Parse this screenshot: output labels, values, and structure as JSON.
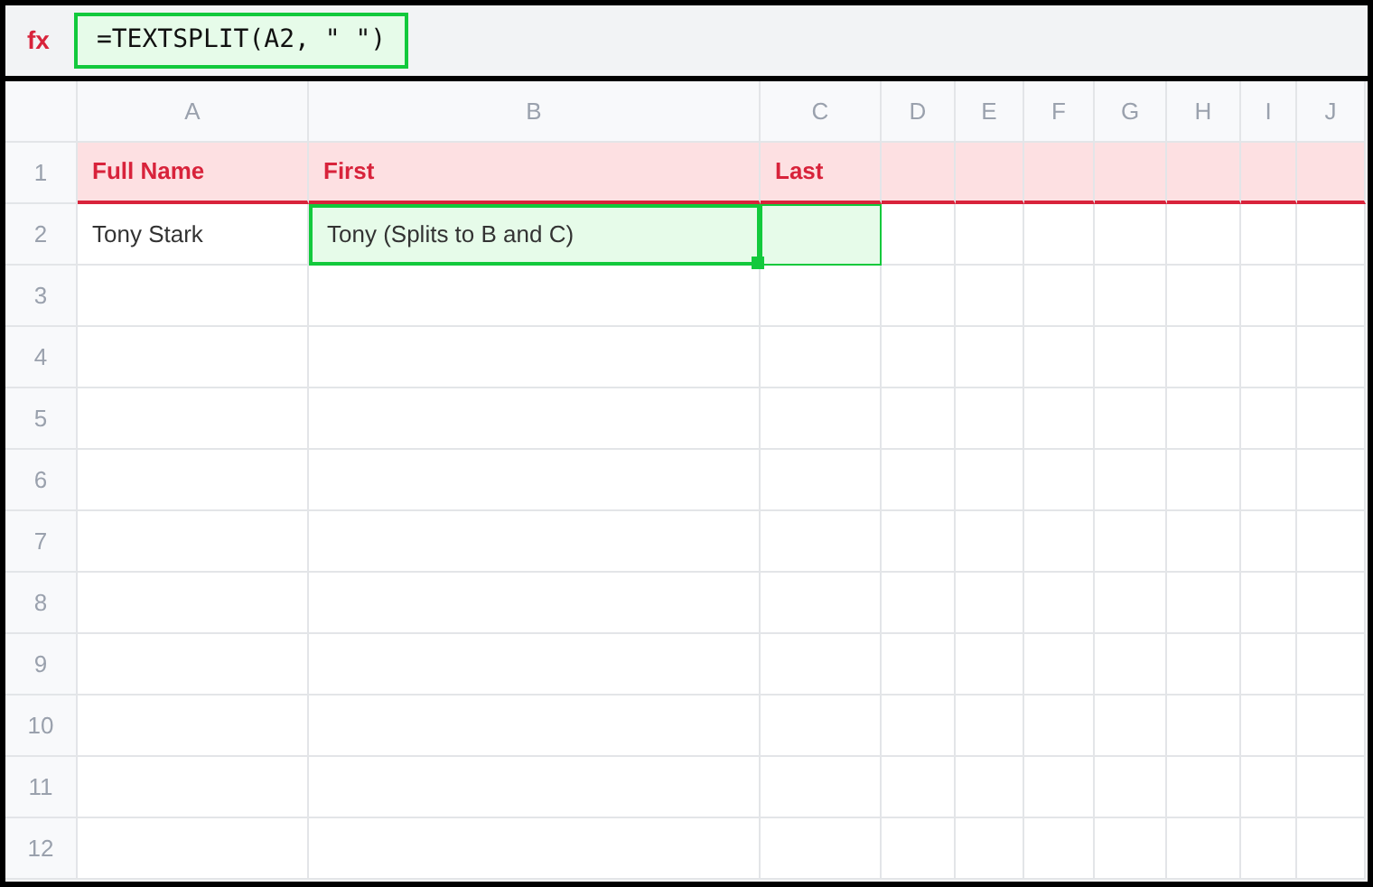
{
  "formula_bar": {
    "label": "fx",
    "formula": "=TEXTSPLIT(A2, \" \")"
  },
  "columns": [
    "A",
    "B",
    "C",
    "D",
    "E",
    "F",
    "G",
    "H",
    "I",
    "J"
  ],
  "rows": [
    {
      "number": "1",
      "kind": "header",
      "cells": [
        {
          "text": "Full Name",
          "selected": false
        },
        {
          "text": "First",
          "selected": false
        },
        {
          "text": "Last",
          "selected": false
        }
      ]
    },
    {
      "number": "2",
      "kind": "data",
      "cells": [
        {
          "text": "Tony Stark",
          "selected": false
        },
        {
          "text": "Tony (Splits to B and C)",
          "selected": true,
          "active": true
        },
        {
          "selected": true,
          "active": false
        }
      ]
    },
    {
      "number": "3"
    },
    {
      "number": "4"
    },
    {
      "number": "5"
    },
    {
      "number": "6"
    },
    {
      "number": "7"
    },
    {
      "number": "8"
    },
    {
      "number": "9"
    },
    {
      "number": "10"
    },
    {
      "number": "11"
    },
    {
      "number": "12"
    }
  ]
}
